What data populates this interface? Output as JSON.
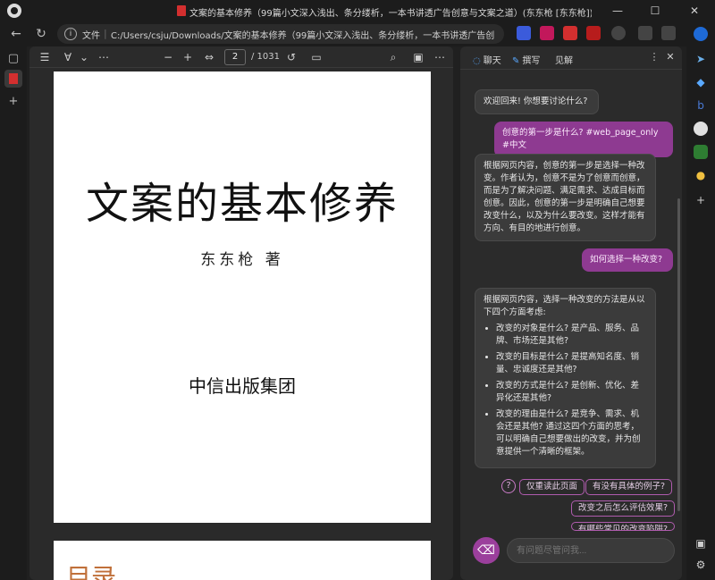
{
  "window": {
    "title": "文案的基本修养（99篇小文深入浅出、条分缕析，一本书讲透广告创意与文案之道）(东东枪 [东东枪]) (Z-Library).pdf",
    "minimize": "—",
    "maximize": "☐",
    "close": "✕"
  },
  "address": {
    "file_label": "文件",
    "url": "C:/Users/csju/Downloads/文案的基本修养（99篇小文深入浅出、条分缕析，一本书讲透广告创..."
  },
  "pdf": {
    "page_current": "2",
    "page_total": "/ 1031",
    "zoom_out": "−",
    "zoom_in": "+",
    "book_title": "文案的基本修养",
    "author": "东东枪 著",
    "publisher": "中信出版集团",
    "next_page_heading": "目录"
  },
  "chat": {
    "tabs": [
      {
        "label": "聊天",
        "icon": "chat-icon"
      },
      {
        "label": "撰写",
        "icon": "compose-icon"
      },
      {
        "label": "见解",
        "icon": "insights-icon"
      }
    ],
    "messages": [
      {
        "role": "bot",
        "text": "欢迎回来! 你想要讨论什么?"
      },
      {
        "role": "user",
        "text": "创意的第一步是什么? #web_page_only #中文"
      },
      {
        "role": "bot",
        "text": "根据网页内容，创意的第一步是选择一种改变。作者认为，创意不是为了创意而创意，而是为了解决问题、满足需求、达成目标而创意。因此，创意的第一步是明确自己想要改变什么，以及为什么要改变。这样才能有方向、有目的地进行创意。"
      },
      {
        "role": "user",
        "text": "如何选择一种改变?"
      },
      {
        "role": "bot",
        "intro": "根据网页内容，选择一种改变的方法是从以下四个方面考虑:",
        "items": [
          "改变的对象是什么? 是产品、服务、品牌、市场还是其他?",
          "改变的目标是什么? 是提高知名度、销量、忠诚度还是其他?",
          "改变的方式是什么? 是创新、优化、差异化还是其他?",
          "改变的理由是什么? 是竞争、需求、机会还是其他? 通过这四个方面的思考，可以明确自己想要做出的改变，并为创意提供一个清晰的框架。"
        ]
      }
    ],
    "suggestions": [
      "仅重读此页面",
      "有没有具体的例子?",
      "改变之后怎么评估效果?",
      "有哪些常见的改变陷阱?"
    ],
    "input_placeholder": "有问题尽管问我..."
  }
}
